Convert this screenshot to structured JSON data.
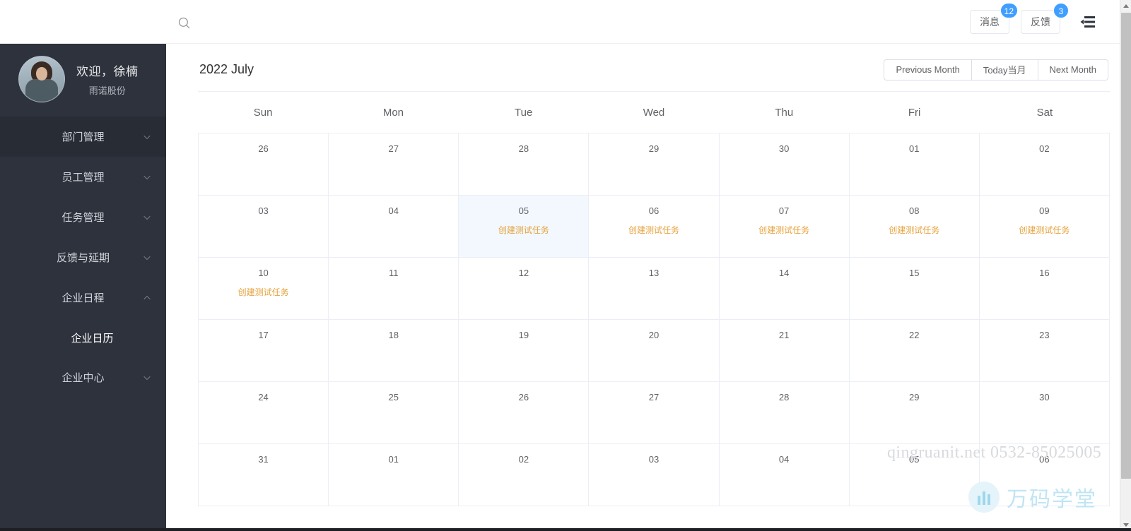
{
  "topbar": {
    "search_icon": "search-icon",
    "buttons": [
      {
        "label": "消息",
        "badge": "12",
        "name": "messages"
      },
      {
        "label": "反馈",
        "badge": "3",
        "name": "feedback"
      }
    ],
    "collapse_icon": "collapse-menu-icon",
    "badge_color": "#409eff"
  },
  "sidebar": {
    "background": "#2e323c",
    "user": {
      "welcome": "欢迎，徐楠",
      "company": "雨诺股份",
      "avatar_icon": "user-avatar"
    },
    "items": [
      {
        "label": "部门管理",
        "chevron": "chevron-down-icon",
        "expanded": false,
        "active": true
      },
      {
        "label": "员工管理",
        "chevron": "chevron-down-icon",
        "expanded": false,
        "active": false
      },
      {
        "label": "任务管理",
        "chevron": "chevron-down-icon",
        "expanded": false,
        "active": false
      },
      {
        "label": "反馈与延期",
        "chevron": "chevron-down-icon",
        "expanded": false,
        "active": false
      },
      {
        "label": "企业日程",
        "chevron": "chevron-up-icon",
        "expanded": true,
        "active": false
      },
      {
        "label": "企业中心",
        "chevron": "chevron-down-icon",
        "expanded": false,
        "active": false
      }
    ],
    "submenu": [
      {
        "label": "企业日历",
        "parent": "企业日程",
        "active": true
      }
    ]
  },
  "calendar": {
    "title": "2022 July",
    "nav": {
      "previous": "Previous Month",
      "today": "Today当月",
      "next": "Next Month"
    },
    "weekdays": [
      "Sun",
      "Mon",
      "Tue",
      "Wed",
      "Thu",
      "Fri",
      "Sat"
    ],
    "event_color": "#e6a23c",
    "selected_bg": "#f2f8fe",
    "cells": [
      {
        "day": "26",
        "event": "",
        "other_month": true,
        "selected": false
      },
      {
        "day": "27",
        "event": "",
        "other_month": true,
        "selected": false
      },
      {
        "day": "28",
        "event": "",
        "other_month": true,
        "selected": false
      },
      {
        "day": "29",
        "event": "",
        "other_month": true,
        "selected": false
      },
      {
        "day": "30",
        "event": "",
        "other_month": true,
        "selected": false
      },
      {
        "day": "01",
        "event": "",
        "other_month": false,
        "selected": false
      },
      {
        "day": "02",
        "event": "",
        "other_month": false,
        "selected": false
      },
      {
        "day": "03",
        "event": "",
        "other_month": false,
        "selected": false
      },
      {
        "day": "04",
        "event": "",
        "other_month": false,
        "selected": false
      },
      {
        "day": "05",
        "event": "创建测试任务",
        "other_month": false,
        "selected": true
      },
      {
        "day": "06",
        "event": "创建测试任务",
        "other_month": false,
        "selected": false
      },
      {
        "day": "07",
        "event": "创建测试任务",
        "other_month": false,
        "selected": false
      },
      {
        "day": "08",
        "event": "创建测试任务",
        "other_month": false,
        "selected": false
      },
      {
        "day": "09",
        "event": "创建测试任务",
        "other_month": false,
        "selected": false
      },
      {
        "day": "10",
        "event": "创建测试任务",
        "other_month": false,
        "selected": false
      },
      {
        "day": "11",
        "event": "",
        "other_month": false,
        "selected": false
      },
      {
        "day": "12",
        "event": "",
        "other_month": false,
        "selected": false
      },
      {
        "day": "13",
        "event": "",
        "other_month": false,
        "selected": false
      },
      {
        "day": "14",
        "event": "",
        "other_month": false,
        "selected": false
      },
      {
        "day": "15",
        "event": "",
        "other_month": false,
        "selected": false
      },
      {
        "day": "16",
        "event": "",
        "other_month": false,
        "selected": false
      },
      {
        "day": "17",
        "event": "",
        "other_month": false,
        "selected": false
      },
      {
        "day": "18",
        "event": "",
        "other_month": false,
        "selected": false
      },
      {
        "day": "19",
        "event": "",
        "other_month": false,
        "selected": false
      },
      {
        "day": "20",
        "event": "",
        "other_month": false,
        "selected": false
      },
      {
        "day": "21",
        "event": "",
        "other_month": false,
        "selected": false
      },
      {
        "day": "22",
        "event": "",
        "other_month": false,
        "selected": false
      },
      {
        "day": "23",
        "event": "",
        "other_month": false,
        "selected": false
      },
      {
        "day": "24",
        "event": "",
        "other_month": false,
        "selected": false
      },
      {
        "day": "25",
        "event": "",
        "other_month": false,
        "selected": false
      },
      {
        "day": "26",
        "event": "",
        "other_month": false,
        "selected": false
      },
      {
        "day": "27",
        "event": "",
        "other_month": false,
        "selected": false
      },
      {
        "day": "28",
        "event": "",
        "other_month": false,
        "selected": false
      },
      {
        "day": "29",
        "event": "",
        "other_month": false,
        "selected": false
      },
      {
        "day": "30",
        "event": "",
        "other_month": false,
        "selected": false
      },
      {
        "day": "31",
        "event": "",
        "other_month": false,
        "selected": false
      },
      {
        "day": "01",
        "event": "",
        "other_month": true,
        "selected": false
      },
      {
        "day": "02",
        "event": "",
        "other_month": true,
        "selected": false
      },
      {
        "day": "03",
        "event": "",
        "other_month": true,
        "selected": false
      },
      {
        "day": "04",
        "event": "",
        "other_month": true,
        "selected": false
      },
      {
        "day": "05",
        "event": "",
        "other_month": true,
        "selected": false
      },
      {
        "day": "06",
        "event": "",
        "other_month": true,
        "selected": false
      }
    ]
  },
  "watermark": {
    "text": "qingruanit.net 0532-85025005",
    "logo_text": "万码学堂"
  }
}
